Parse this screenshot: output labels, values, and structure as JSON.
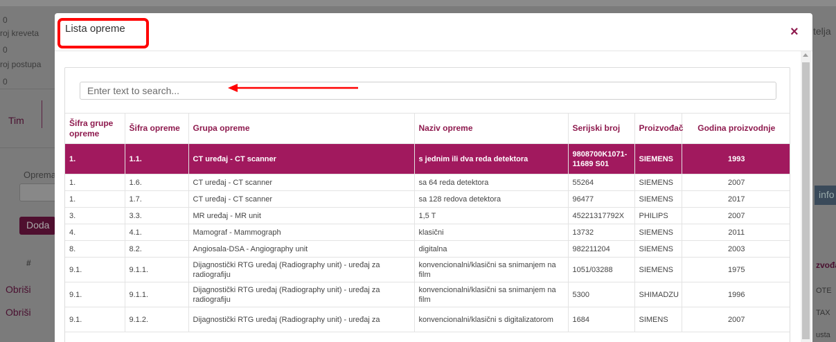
{
  "background": {
    "zero_values": [
      "0",
      "0",
      "0"
    ],
    "label_kreveta": "roj kreveta",
    "label_postupa": "roj postupa",
    "tab_label": "Tim",
    "oprema_label": "Oprema:",
    "add_button": "Doda",
    "hash_header": "#",
    "delete_labels": [
      "Obriši",
      "Obriši"
    ],
    "right_partial_title": "telja",
    "right_button": "info",
    "right_header": "zvođač",
    "right_cells": [
      "OTE",
      "TAX",
      "usta"
    ]
  },
  "modal": {
    "title": "Lista opreme",
    "close_symbol": "×",
    "search_placeholder": "Enter text to search...",
    "columns": [
      "Šifra grupe opreme",
      "Šifra opreme",
      "Grupa opreme",
      "Naziv opreme",
      "Serijski broj",
      "Proizvođač",
      "Godina proizvodnje"
    ],
    "rows": [
      {
        "group_code": "1.",
        "code": "1.1.",
        "group": "CT uređaj - CT scanner",
        "name": "s jednim ili dva reda detektora",
        "serial": "9808700K1071-11689 S01",
        "maker": "SIEMENS",
        "year": "1993",
        "selected": true
      },
      {
        "group_code": "1.",
        "code": "1.6.",
        "group": "CT uređaj - CT scanner",
        "name": "sa 64 reda detektora",
        "serial": "55264",
        "maker": "SIEMENS",
        "year": "2007"
      },
      {
        "group_code": "1.",
        "code": "1.7.",
        "group": "CT uređaj - CT scanner",
        "name": "sa 128 redova detektora",
        "serial": "96477",
        "maker": "SIEMENS",
        "year": "2017"
      },
      {
        "group_code": "3.",
        "code": "3.3.",
        "group": "MR uređaj - MR unit",
        "name": "1,5 T",
        "serial": "45221317792X",
        "maker": "PHILIPS",
        "year": "2007"
      },
      {
        "group_code": "4.",
        "code": "4.1.",
        "group": "Mamograf - Mammograph",
        "name": "klasični",
        "serial": "13732",
        "maker": "SIEMENS",
        "year": "2011"
      },
      {
        "group_code": "8.",
        "code": "8.2.",
        "group": "Angiosala-DSA - Angiography unit",
        "name": "digitalna",
        "serial": "982211204",
        "maker": "SIEMENS",
        "year": "2003"
      },
      {
        "group_code": "9.1.",
        "code": "9.1.1.",
        "group": "Dijagnostički RTG uređaj (Radiography unit) - uređaj za radiografiju",
        "name": "konvencionalni/klasični sa snimanjem na film",
        "serial": "1051/03288",
        "maker": "SIEMENS",
        "year": "1975"
      },
      {
        "group_code": "9.1.",
        "code": "9.1.1.",
        "group": "Dijagnostički RTG uređaj (Radiography unit) - uređaj za radiografiju",
        "name": "konvencionalni/klasični sa snimanjem na film",
        "serial": "5300",
        "maker": "SHIMADZU",
        "year": "1996"
      },
      {
        "group_code": "9.1.",
        "code": "9.1.2.",
        "group": "Dijagnostički RTG uređaj (Radiography unit) - uređaj za",
        "name": "konvencionalni/klasični s digitalizatorom",
        "serial": "1684",
        "maker": "SIMENS",
        "year": "2007"
      }
    ]
  },
  "colors": {
    "accent": "#8e1a4e",
    "selected_row": "#a1195e",
    "annotation_red": "#ff0000"
  }
}
